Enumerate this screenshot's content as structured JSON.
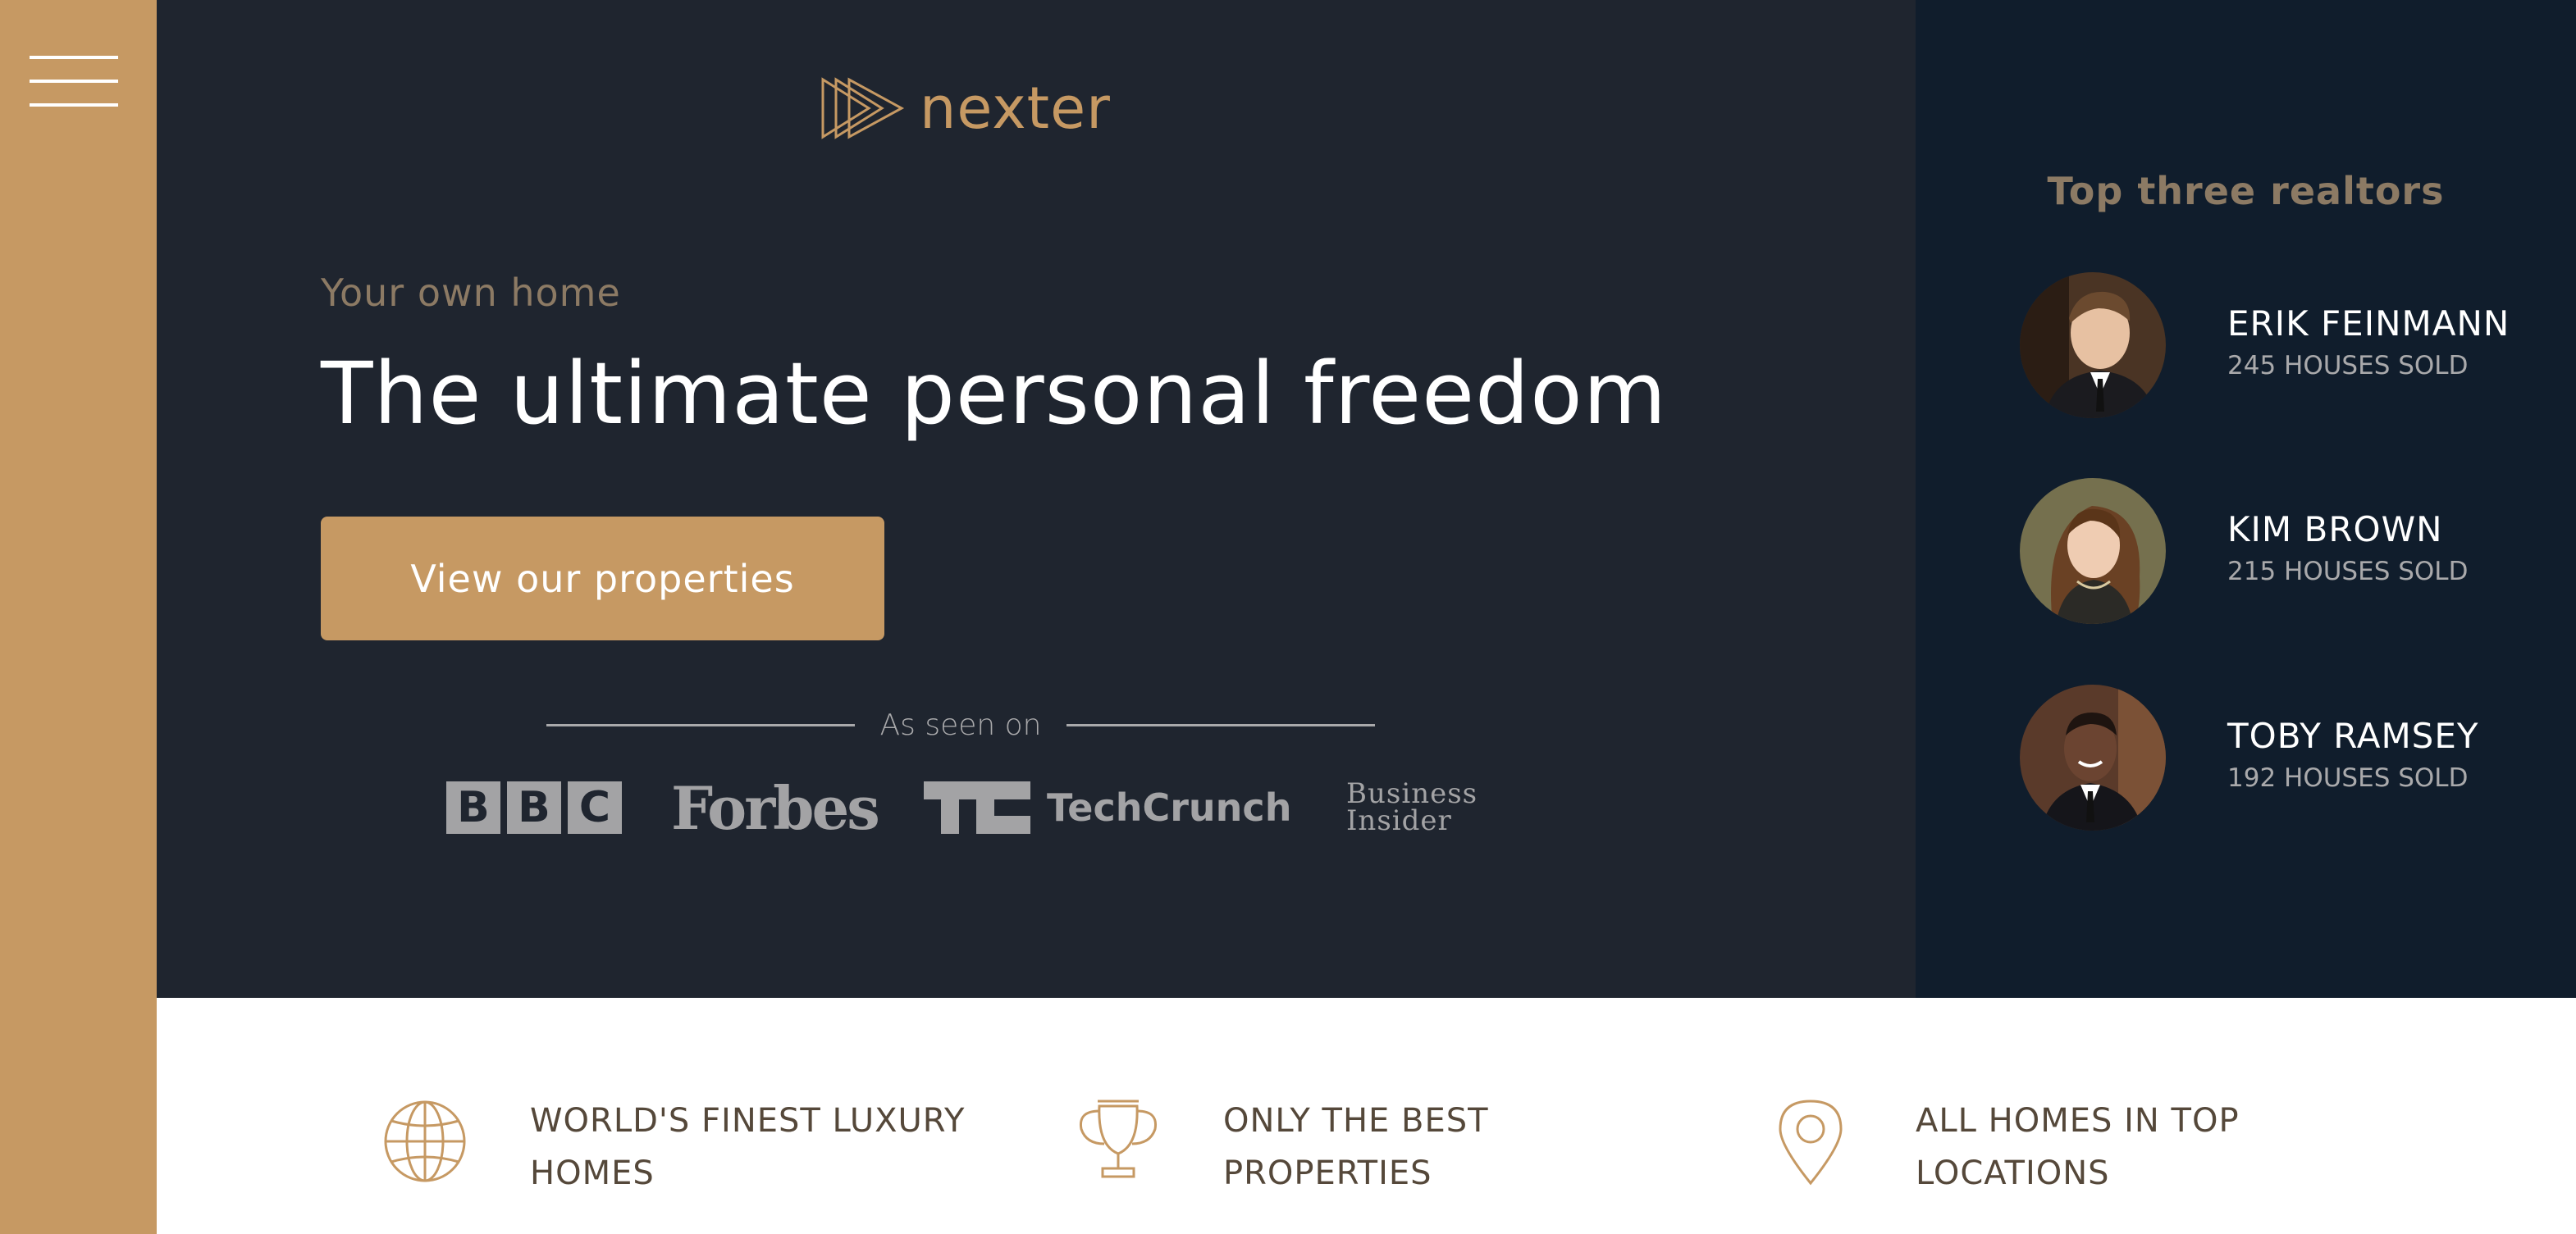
{
  "sidebar": {
    "menu_icon": "hamburger-menu-icon"
  },
  "header": {
    "logo_text": "nexter",
    "subheading": "Your own home",
    "heading": "The ultimate personal freedom",
    "cta_label": "View our properties",
    "seen_on_label": "As seen on",
    "brands": {
      "bbc": [
        "B",
        "B",
        "C"
      ],
      "forbes": "Forbes",
      "techcrunch": "TechCrunch",
      "business_insider_line1": "Business",
      "business_insider_line2": "Insider"
    }
  },
  "realtors": {
    "title": "Top three realtors",
    "items": [
      {
        "name": "ERIK FEINMANN",
        "sold": "245 HOUSES SOLD"
      },
      {
        "name": "KIM BROWN",
        "sold": "215 HOUSES SOLD"
      },
      {
        "name": "TOBY RAMSEY",
        "sold": "192 HOUSES SOLD"
      }
    ]
  },
  "features": [
    {
      "icon": "globe-icon",
      "text": "WORLD'S FINEST LUXURY HOMES"
    },
    {
      "icon": "trophy-icon",
      "text": "ONLY THE BEST PROPERTIES"
    },
    {
      "icon": "map-pin-icon",
      "text": "ALL HOMES IN TOP LOCATIONS"
    }
  ],
  "colors": {
    "primary": "#c69963",
    "header_bg": "#1f252f",
    "realtors_bg": "#101d2c",
    "muted": "#8c7a64",
    "grey": "#a9a9ab",
    "feature_text": "#55483a"
  }
}
